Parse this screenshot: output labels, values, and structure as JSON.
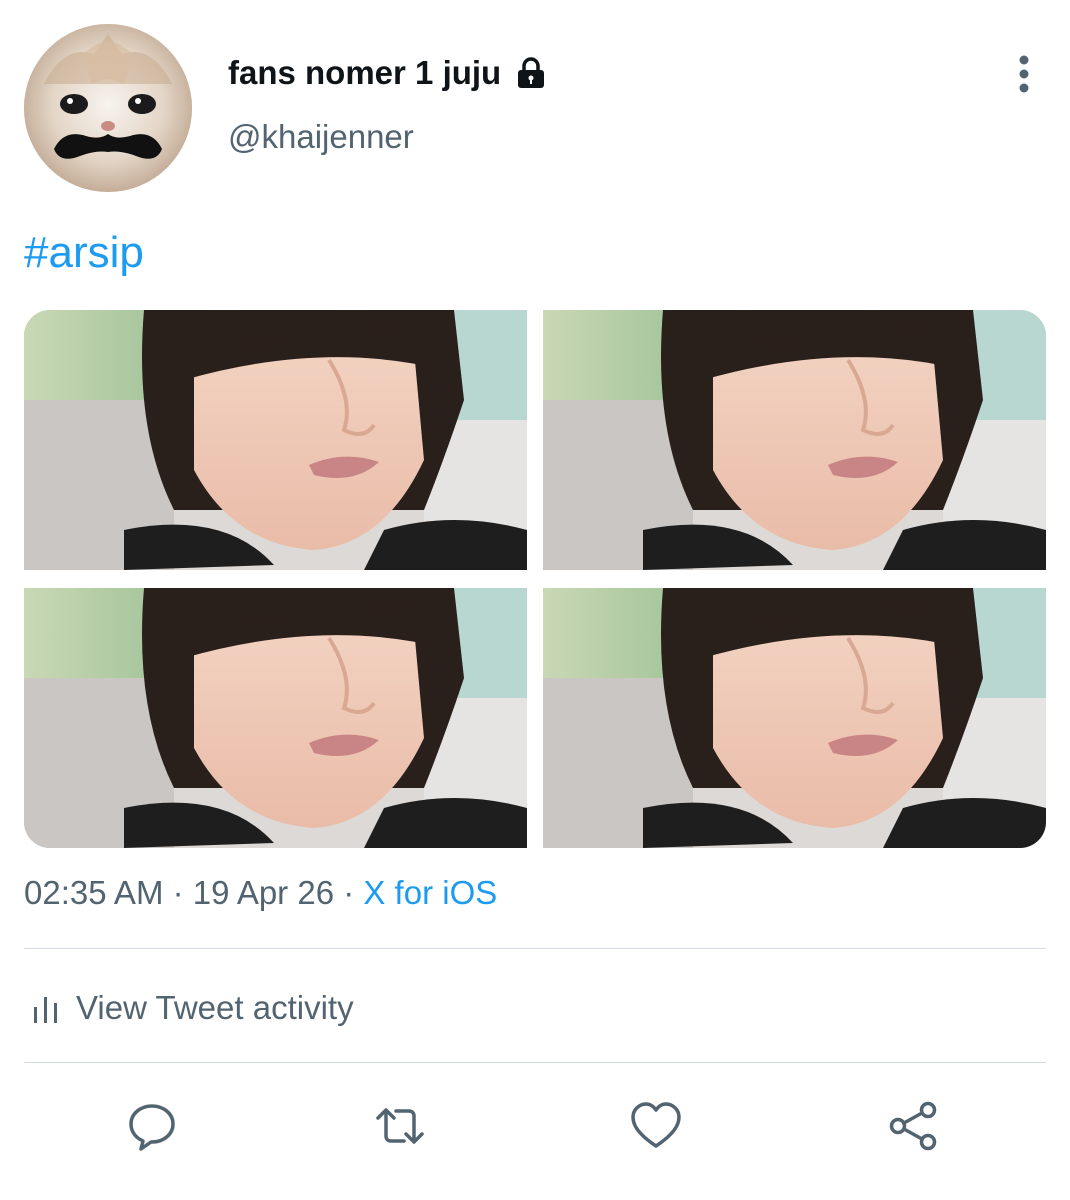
{
  "profile": {
    "display_name": "fans nomer 1 juju",
    "handle": "@khaijenner",
    "avatar_icon": "cat-with-mustache-avatar",
    "protected_icon": "lock-icon"
  },
  "tweet": {
    "text": "#arsip",
    "media_count": 4
  },
  "meta": {
    "time": "02:35 AM",
    "separator1": " · ",
    "date": "19 Apr 26",
    "separator2": " · ",
    "source": "X for iOS"
  },
  "activity": {
    "label": "View Tweet activity",
    "icon": "analytics-bars-icon"
  },
  "actions": [
    {
      "name": "reply",
      "icon": "reply-icon"
    },
    {
      "name": "retweet",
      "icon": "retweet-icon"
    },
    {
      "name": "like",
      "icon": "heart-icon"
    },
    {
      "name": "share",
      "icon": "share-icon"
    }
  ],
  "colors": {
    "accent": "#1d9bf0",
    "text_primary": "#0f1419",
    "text_secondary": "#536471",
    "divider": "#d3dbe1"
  }
}
